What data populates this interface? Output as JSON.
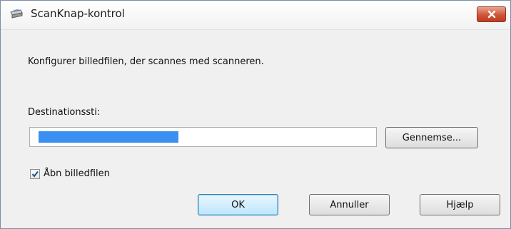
{
  "window": {
    "title": "ScanKnap-kontrol",
    "close_icon": "close-icon",
    "app_icon": "scanner-icon"
  },
  "dialog": {
    "description": "Konfigurer billedfilen, der scannes med scanneren.",
    "destination_label": "Destinationssti:",
    "destination_value": "",
    "browse_label": "Gennemse...",
    "open_file_label": "Åbn billedfilen",
    "open_file_checked": true
  },
  "buttons": {
    "ok": "OK",
    "cancel": "Annuller",
    "help": "Hjælp"
  },
  "colors": {
    "selection": "#3a8ff0",
    "close": "#c9442a"
  }
}
